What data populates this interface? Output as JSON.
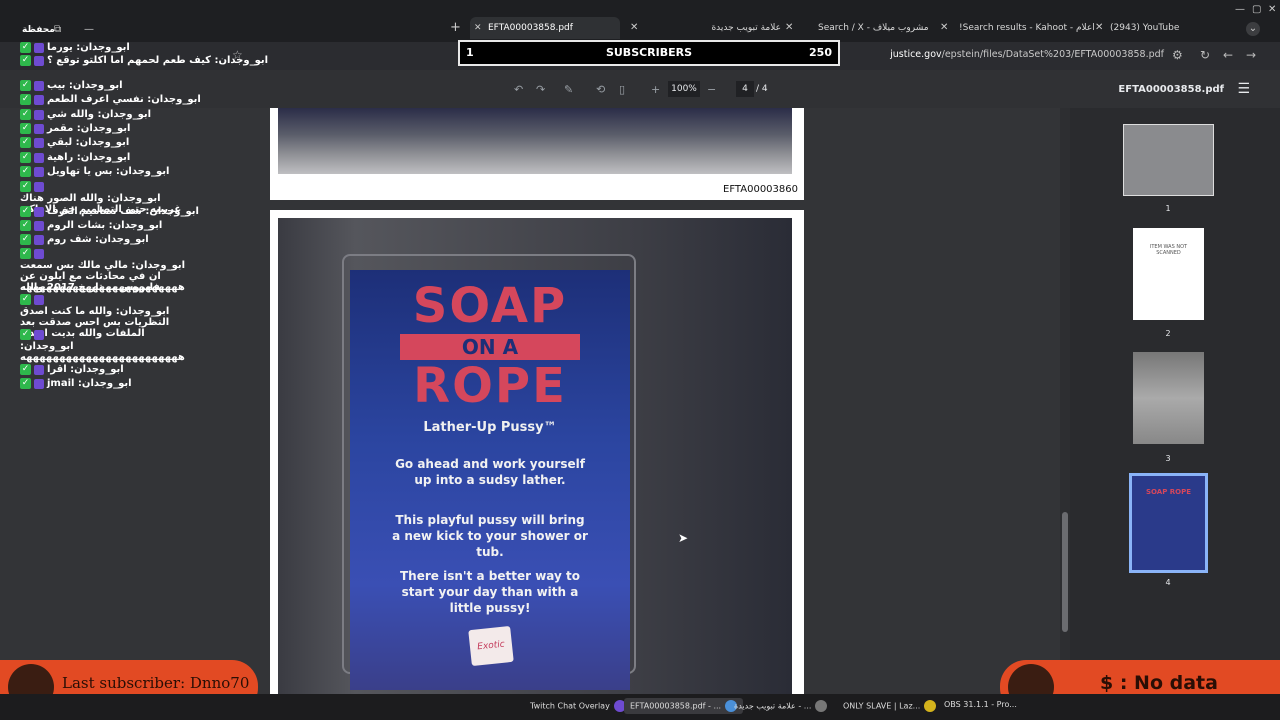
{
  "browser": {
    "tabs": [
      {
        "title": "EFTA00003858.pdf",
        "active": true
      },
      {
        "title": "علامة تبويب جديدة",
        "active": false
      },
      {
        "title": "Search / X - مشروب ميلاف",
        "active": false
      },
      {
        "title": "!Search results - Kahoot - اعلام",
        "active": false
      },
      {
        "title": "(2943) YouTube",
        "active": false
      }
    ],
    "url_domain": "justice.gov",
    "url_path": "/epstein/files/DataSet%203/EFTA00003858.pdf",
    "saved_label": "محفظة"
  },
  "subscriber_goal": {
    "current": "1",
    "label": "SUBSCRIBERS",
    "target": "250"
  },
  "pdf_toolbar": {
    "zoom": "100%",
    "page_current": "4",
    "page_separator": "/",
    "page_total": "4",
    "doc_name": "EFTA00003858.pdf"
  },
  "pdf": {
    "page3_label": "EFTA00003860",
    "product": {
      "line1": "SOAP",
      "line2": "ON A",
      "line3": "ROPE",
      "tagline": "Lather-Up Pussy™",
      "copy": [
        "Go ahead and work yourself up into a sudsy lather.",
        "This playful pussy will bring a new kick to your shower or tub.",
        "There isn't a better way to start your day than with a little pussy!"
      ],
      "logo_text": "Exotic"
    }
  },
  "thumbnails": [
    {
      "num": "1",
      "text": ""
    },
    {
      "num": "2",
      "text": "ITEM WAS NOT SCANNED"
    },
    {
      "num": "3",
      "text": ""
    },
    {
      "num": "4",
      "text": "SOAP ROPE"
    }
  ],
  "chat": [
    {
      "text": "ابو_وجدان: يورما"
    },
    {
      "text": "ابو_وجدان: كيف طعم لحمهم اما اكلتو توقع ؟"
    },
    {
      "text": "ابو_وجدان: بيب"
    },
    {
      "text": "ابو_وجدان: نفسي اعرف الطعم"
    },
    {
      "text": "ابو_وجدان: والله شي"
    },
    {
      "text": "ابو_وجدان: مقمر"
    },
    {
      "text": "ابو_وجدان: لبقي"
    },
    {
      "text": "ابو_وجدان: راهية"
    },
    {
      "text": "ابو_وجدان: بس يا تهاويل"
    },
    {
      "text": "ابو_وجدان: والله الصور هناك غريبيه حتى التصاميم حق الاماكن"
    },
    {
      "text": "ابو_وجدان: شف تصاميم الغرف"
    },
    {
      "text": "ابو_وجدان: بشات الروم"
    },
    {
      "text": "ابو_وجدان: شف روم"
    },
    {
      "text": "ابو_وجدان: مالي مالك بس سمعت ان في محادثات مع ايلون عن فايروس ب تاريخ 2017 والله"
    },
    {
      "text": "ههههههههههههههههههههههههه"
    },
    {
      "text": "ابو_وجدان: والله ما كنت اصدق النظريات بس احس صدقت بعد الملفات والله بديت اصدق"
    },
    {
      "text": ""
    },
    {
      "text": "ابو_وجدان: ههههههههههههههههههههههههه"
    },
    {
      "text": "ابو_وجدان: اقرا"
    },
    {
      "text": "ابو_وجدان: jmail"
    }
  ],
  "last_subscriber": {
    "label": "Last subscriber: Dnno70"
  },
  "donation": {
    "label": "$ : No data"
  },
  "taskbar": [
    {
      "label": "Twitch Chat Overlay",
      "active": false
    },
    {
      "label": "EFTA00003858.pdf - ...",
      "active": true
    },
    {
      "label": "علامة تبويب جديدة - ...",
      "active": false
    },
    {
      "label": "ONLY SLAVE | Laz...",
      "active": false
    },
    {
      "label": "OBS 31.1.1 - Pro...",
      "active": false
    }
  ],
  "colors": {
    "overlay_orange": "#e24a23",
    "chat_check": "#2eb84c",
    "toolbar_bg": "#303134"
  }
}
